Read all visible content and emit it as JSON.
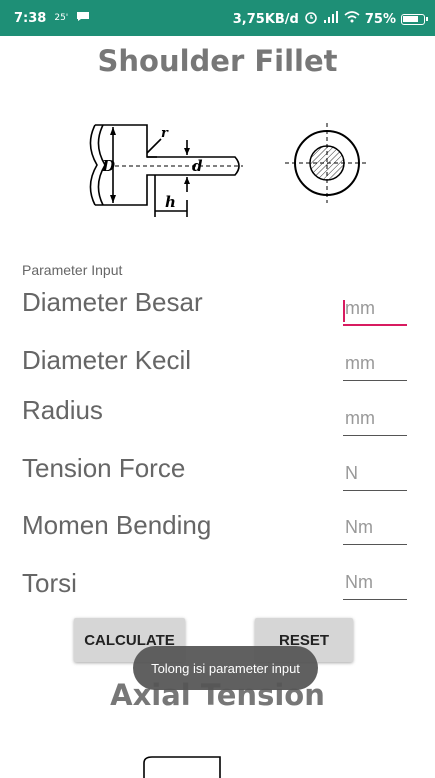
{
  "status_bar": {
    "time": "7:38",
    "small_indicator": "25'",
    "network_speed": "3,75KB/d",
    "battery": "75%",
    "icons": [
      "notification-icon",
      "alarm-icon",
      "signal-icon",
      "wifi-icon",
      "battery-icon"
    ]
  },
  "header": {
    "title": "Shoulder Fillet"
  },
  "diagram": {
    "labels": {
      "D": "D",
      "d": "d",
      "h": "h",
      "r": "r"
    }
  },
  "form": {
    "section_label": "Parameter Input",
    "rows": [
      {
        "label": "Diameter Besar",
        "unit": "mm"
      },
      {
        "label": "Diameter Kecil",
        "unit": "mm"
      },
      {
        "label": "Radius",
        "unit": "mm"
      },
      {
        "label": "Tension Force",
        "unit": "N"
      },
      {
        "label": "Momen Bending",
        "unit": "Nm"
      },
      {
        "label": "Torsi",
        "unit": "Nm"
      }
    ]
  },
  "buttons": {
    "calculate": "CALCULATE",
    "reset": "RESET"
  },
  "toast": {
    "message": "Tolong isi parameter input"
  },
  "next_section": {
    "title": "Axial Tension"
  },
  "colors": {
    "status_bar": "#1e8f76",
    "accent": "#d81b60",
    "label_text": "#666666"
  }
}
